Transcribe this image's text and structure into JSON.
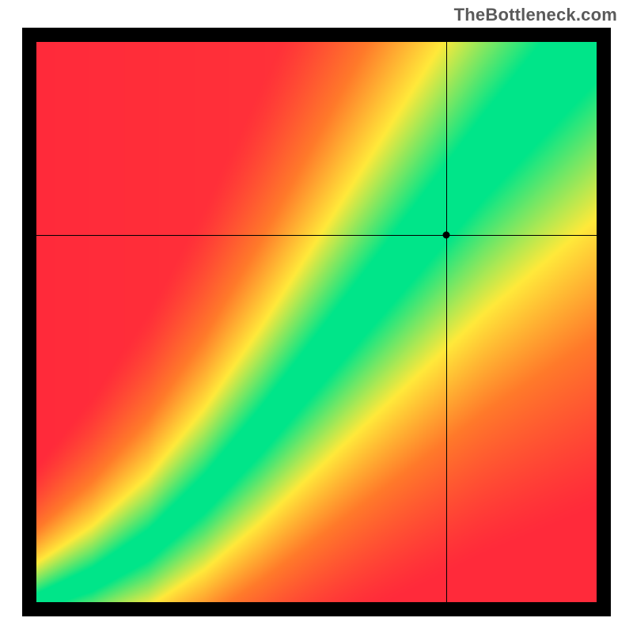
{
  "watermark": "TheBottleneck.com",
  "chart_data": {
    "type": "heatmap",
    "title": "",
    "xlabel": "",
    "ylabel": "",
    "xlim": [
      0,
      1
    ],
    "ylim": [
      0,
      1
    ],
    "note": "Values are colors (red→yellow→green) encoding distance from an optimal curve; green = optimal, red = severe bottleneck.",
    "optimal_curve": [
      {
        "x": 0.0,
        "y": 0.0
      },
      {
        "x": 0.1,
        "y": 0.04
      },
      {
        "x": 0.2,
        "y": 0.1
      },
      {
        "x": 0.3,
        "y": 0.19
      },
      {
        "x": 0.4,
        "y": 0.3
      },
      {
        "x": 0.5,
        "y": 0.42
      },
      {
        "x": 0.6,
        "y": 0.54
      },
      {
        "x": 0.7,
        "y": 0.66
      },
      {
        "x": 0.8,
        "y": 0.78
      },
      {
        "x": 0.9,
        "y": 0.89
      },
      {
        "x": 1.0,
        "y": 1.0
      }
    ],
    "green_band_halfwidth_at": {
      "x0": 0.015,
      "x1": 0.07
    },
    "marker": {
      "x": 0.732,
      "y": 0.655
    },
    "colors": {
      "red": "#ff2a3a",
      "orange": "#ff7a2a",
      "yellow": "#ffe93a",
      "green": "#00e589"
    }
  }
}
